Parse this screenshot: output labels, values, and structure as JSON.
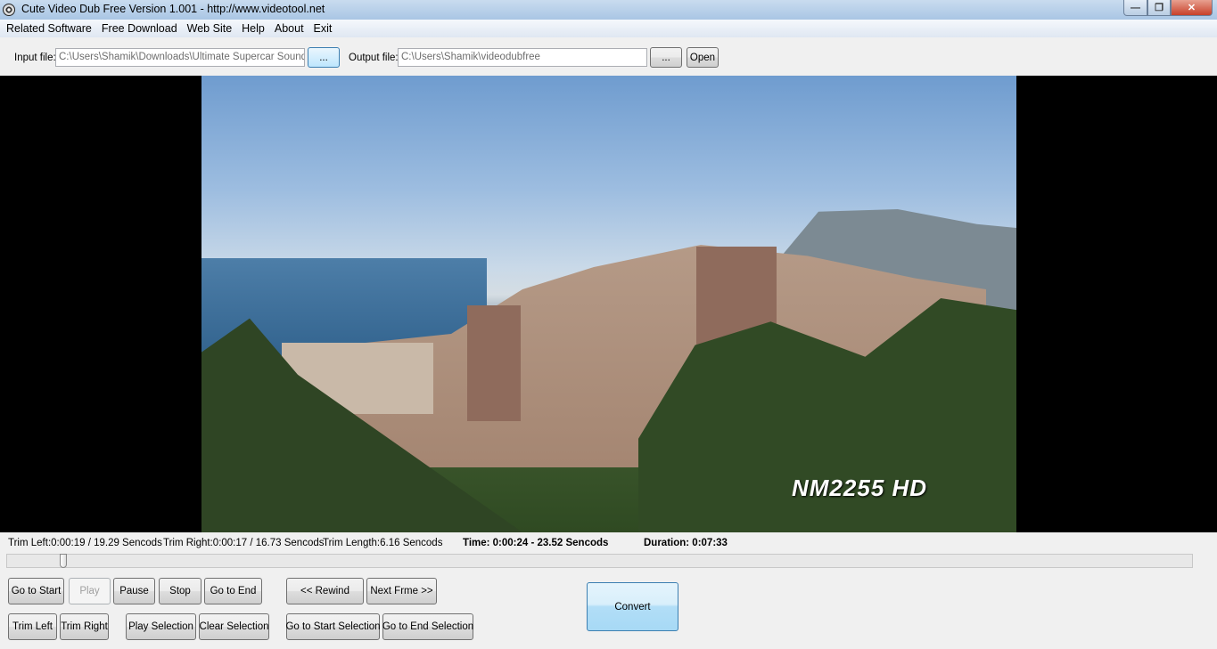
{
  "window": {
    "title": "Cute Video Dub Free Version  1.001  - http://www.videotool.net"
  },
  "menu": [
    "Related Software",
    "Free Download",
    "Web Site",
    "Help",
    "About",
    "Exit"
  ],
  "files": {
    "input_label": "Input file:",
    "input_value": "C:\\Users\\Shamik\\Downloads\\Ultimate Supercar Sounds i",
    "browse_label": "...",
    "output_label": "Output file:",
    "output_value": "C:\\Users\\Shamik\\videodubfree",
    "open_label": "Open"
  },
  "video": {
    "watermark": "NM2255 HD"
  },
  "status": {
    "trim_left": "Trim Left:0:00:19 / 19.29 Sencods",
    "trim_right": "Trim Right:0:00:17 / 16.73 Sencods",
    "trim_length": "Trim Length:6.16 Sencods",
    "time": "Time: 0:00:24 - 23.52 Sencods",
    "duration": "Duration: 0:07:33"
  },
  "seek": {
    "position_fraction": 0.045
  },
  "buttons": {
    "go_to_start": "Go to Start",
    "play": "Play",
    "pause": "Pause",
    "stop": "Stop",
    "go_to_end": "Go to End",
    "rewind": "<< Rewind",
    "next_frame": "Next Frme >>",
    "trim_left": "Trim Left",
    "trim_right": "Trim Right",
    "play_selection": "Play Selection",
    "clear_selection": "Clear Selection",
    "go_to_start_selection": "Go to Start Selection",
    "go_to_end_selection": "Go to End Selection",
    "convert": "Convert"
  }
}
